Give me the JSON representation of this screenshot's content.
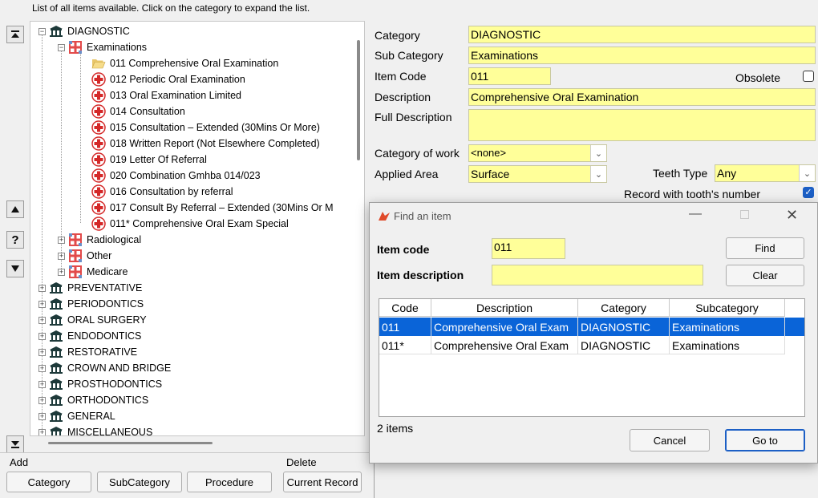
{
  "hint": "List of all items available. Click on the category to expand the list.",
  "side": {
    "question": "?"
  },
  "tree": {
    "diagnostic": "DIAGNOSTIC",
    "examinations": "Examinations",
    "items": [
      "011 Comprehensive Oral Examination",
      "012 Periodic Oral Examination",
      "013 Oral Examination Limited",
      "014 Consultation",
      "015 Consultation – Extended (30Mins Or More)",
      "018 Written Report (Not Elsewhere Completed)",
      "019 Letter Of Referral",
      "020 Combination Gmhba 014/023",
      "016 Consultation by referral",
      "017 Consult By Referral – Extended  (30Mins Or M",
      "011* Comprehensive Oral Exam Special"
    ],
    "subcats": [
      "Radiological",
      "Other",
      "Medicare"
    ],
    "cats": [
      "PREVENTATIVE",
      "PERIODONTICS",
      "ORAL SURGERY",
      "ENDODONTICS",
      "RESTORATIVE",
      "CROWN AND BRIDGE",
      "PROSTHODONTICS",
      "ORTHODONTICS",
      "GENERAL",
      "MISCELLANEOUS"
    ]
  },
  "bottom": {
    "add": "Add",
    "delete": "Delete",
    "category": "Category",
    "subcategory": "SubCategory",
    "procedure": "Procedure",
    "current_record": "Current Record"
  },
  "form": {
    "category_label": "Category",
    "category": "DIAGNOSTIC",
    "subcategory_label": "Sub Category",
    "subcategory": "Examinations",
    "itemcode_label": "Item Code",
    "itemcode": "011",
    "obsolete_label": "Obsolete",
    "description_label": "Description",
    "description": "Comprehensive Oral Examination",
    "fulldesc_label": "Full Description",
    "fulldesc": "",
    "work_label": "Category of work",
    "work": "<none>",
    "area_label": "Applied Area",
    "area": "Surface",
    "teeth_label": "Teeth Type",
    "teeth": "Any",
    "record_label": "Record with tooth's number"
  },
  "dialog": {
    "title": "Find an item",
    "code_label": "Item code",
    "code": "011",
    "desc_label": "Item description",
    "desc": "",
    "find": "Find",
    "clear": "Clear",
    "headers": [
      "Code",
      "Description",
      "Category",
      "Subcategory"
    ],
    "rows": [
      [
        "011",
        "Comprehensive Oral Exam",
        "DIAGNOSTIC",
        "Examinations"
      ],
      [
        "011*",
        "Comprehensive Oral Exam",
        "DIAGNOSTIC",
        "Examinations"
      ]
    ],
    "count": "2 items",
    "cancel": "Cancel",
    "goto": "Go to"
  },
  "colors": {
    "field": "#ffff99",
    "selection": "#0a64d8",
    "accent": "#1c5fc5"
  }
}
